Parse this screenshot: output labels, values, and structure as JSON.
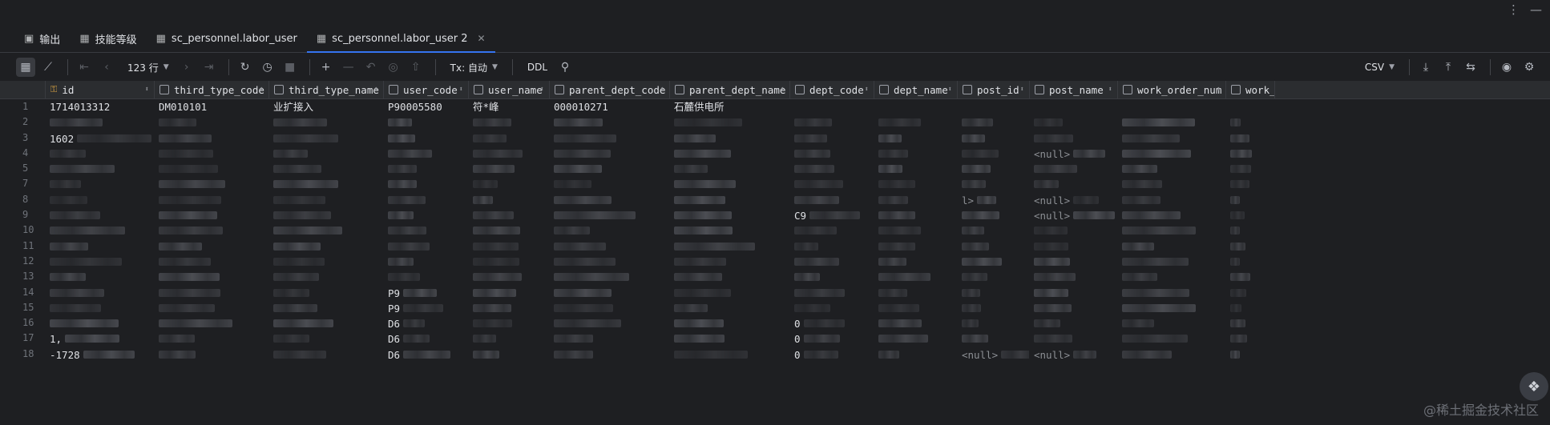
{
  "tabs": [
    {
      "icon": "console-icon",
      "label": "输出"
    },
    {
      "icon": "table-icon",
      "label": "技能等级"
    },
    {
      "icon": "table-icon",
      "label": "sc_personnel.labor_user"
    },
    {
      "icon": "table-icon",
      "label": "sc_personnel.labor_user 2",
      "active": true
    }
  ],
  "toolbar": {
    "rows_label": "123 行",
    "tx_label": "Tx: 自动",
    "ddl_label": "DDL",
    "export_format": "CSV"
  },
  "columns": [
    {
      "name": "id",
      "key": true
    },
    {
      "name": "third_type_code"
    },
    {
      "name": "third_type_name"
    },
    {
      "name": "user_code"
    },
    {
      "name": "user_name"
    },
    {
      "name": "parent_dept_code"
    },
    {
      "name": "parent_dept_name"
    },
    {
      "name": "dept_code"
    },
    {
      "name": "dept_name"
    },
    {
      "name": "post_id"
    },
    {
      "name": "post_name"
    },
    {
      "name": "work_order_num"
    },
    {
      "name": "work_ord"
    }
  ],
  "rows": [
    {
      "num": "1",
      "cells": [
        "1714013312",
        "DM010101",
        "业扩接入",
        "P90005580",
        "符*峰",
        "000010271",
        "石麓供电所",
        "",
        "",
        "",
        "",
        "",
        ""
      ]
    },
    {
      "num": "2",
      "cells": [
        "",
        "",
        "",
        "",
        "",
        "",
        "",
        "",
        "",
        "",
        "",
        "",
        ""
      ]
    },
    {
      "num": "3",
      "cells": [
        "1602",
        "",
        "",
        "",
        "",
        "",
        "",
        "",
        "",
        "",
        "",
        "",
        ""
      ]
    },
    {
      "num": "4",
      "cells": [
        "",
        "",
        "",
        "",
        "",
        "",
        "",
        "",
        "",
        "",
        "<null>",
        "",
        ""
      ]
    },
    {
      "num": "5",
      "cells": [
        "",
        "",
        "",
        "",
        "",
        "",
        "",
        "",
        "",
        "",
        "",
        "",
        ""
      ]
    },
    {
      "num": "7",
      "cells": [
        "",
        "",
        "",
        "",
        "",
        "",
        "",
        "",
        "",
        "",
        "",
        "",
        ""
      ]
    },
    {
      "num": "8",
      "cells": [
        "",
        "",
        "",
        "",
        "",
        "",
        "",
        "",
        "",
        "l>",
        "<null>",
        "",
        ""
      ]
    },
    {
      "num": "9",
      "cells": [
        "",
        "",
        "",
        "",
        "",
        "",
        "",
        "C9",
        "",
        "",
        "<null>",
        "",
        ""
      ]
    },
    {
      "num": "10",
      "cells": [
        "",
        "",
        "",
        "",
        "",
        "",
        "",
        "",
        "",
        "",
        "",
        "",
        ""
      ]
    },
    {
      "num": "11",
      "cells": [
        "",
        "",
        "",
        "",
        "",
        "",
        "",
        "",
        "",
        "",
        "",
        "",
        ""
      ]
    },
    {
      "num": "12",
      "cells": [
        "",
        "",
        "",
        "",
        "",
        "",
        "",
        "",
        "",
        "",
        "",
        "",
        ""
      ]
    },
    {
      "num": "13",
      "cells": [
        "",
        "",
        "",
        "",
        "",
        "",
        "",
        "",
        "",
        "",
        "",
        "",
        ""
      ]
    },
    {
      "num": "14",
      "cells": [
        "",
        "",
        "",
        "P9",
        "",
        "",
        "",
        "",
        "",
        "",
        "",
        "",
        ""
      ]
    },
    {
      "num": "15",
      "cells": [
        "",
        "",
        "",
        "P9",
        "",
        "",
        "",
        "",
        "",
        "",
        "",
        "",
        ""
      ]
    },
    {
      "num": "16",
      "cells": [
        "",
        "",
        "",
        "D6",
        "",
        "",
        "",
        "0",
        "",
        "",
        "",
        "",
        ""
      ]
    },
    {
      "num": "17",
      "cells": [
        "1,",
        "",
        "",
        "D6",
        "",
        "",
        "",
        "0",
        "",
        "",
        "",
        "",
        ""
      ]
    },
    {
      "num": "18",
      "cells": [
        "-1728",
        "",
        "",
        "D6",
        "",
        "",
        "",
        "0",
        "",
        "<null>",
        "<null>",
        "",
        ""
      ]
    }
  ],
  "watermark": "@稀土掘金技术社区"
}
